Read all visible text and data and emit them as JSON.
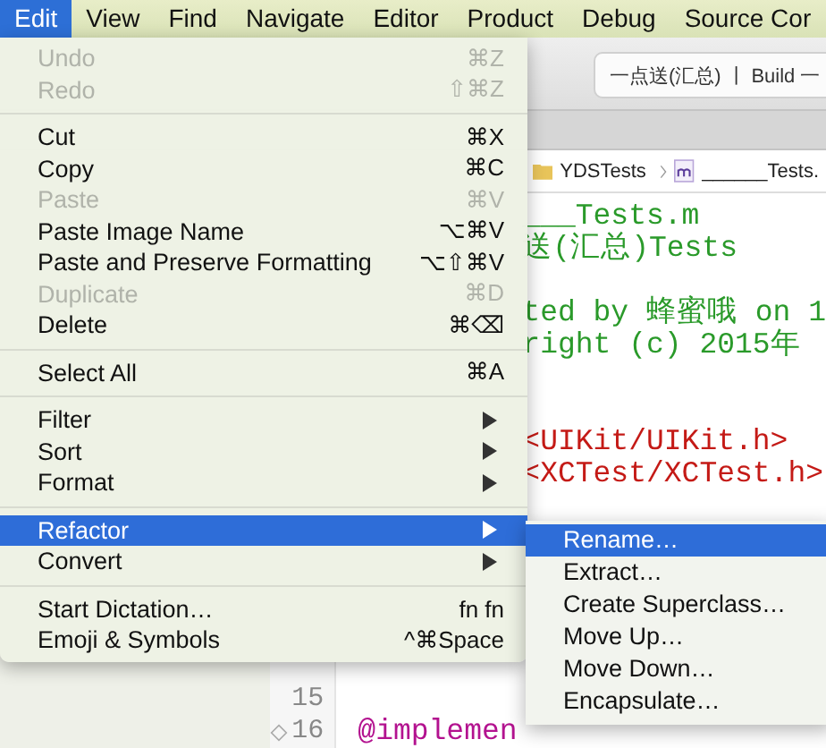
{
  "menubar": [
    {
      "label": "Edit",
      "selected": true
    },
    {
      "label": "View",
      "selected": false
    },
    {
      "label": "Find",
      "selected": false
    },
    {
      "label": "Navigate",
      "selected": false
    },
    {
      "label": "Editor",
      "selected": false
    },
    {
      "label": "Product",
      "selected": false
    },
    {
      "label": "Debug",
      "selected": false
    },
    {
      "label": "Source Cor",
      "selected": false
    }
  ],
  "toolbar": {
    "scheme": "一点送(汇总)",
    "divider": "|",
    "status": "Build 一"
  },
  "breadcrumb": [
    "YDSTests",
    "______Tests."
  ],
  "code_lines": [
    {
      "kind": "comment",
      "text": "___Tests.m"
    },
    {
      "kind": "comment",
      "text": "送(汇总)Tests"
    },
    {
      "kind": "blank"
    },
    {
      "kind": "comment",
      "text": "ted by 蜂蜜哦 on 1"
    },
    {
      "kind": "comment",
      "text": "right (c) 2015年"
    },
    {
      "kind": "blank"
    },
    {
      "kind": "blank"
    },
    {
      "kind": "directive",
      "text": "<UIKit/UIKit.h>"
    },
    {
      "kind": "directive",
      "text": "<XCTest/XCTest.h>"
    },
    {
      "kind": "blank"
    },
    {
      "kind": "blank"
    },
    {
      "kind": "blank"
    },
    {
      "kind": "blank"
    },
    {
      "kind": "blank"
    },
    {
      "kind": "blank"
    },
    {
      "kind": "blank",
      "number": "15"
    },
    {
      "kind": "keyword",
      "number": "16",
      "text": "@implemen"
    }
  ],
  "edit_menu": [
    {
      "kind": "item",
      "label": "Undo",
      "shortcut": "⌘Z",
      "disabled": true,
      "selected": false
    },
    {
      "kind": "item",
      "label": "Redo",
      "shortcut": "⇧⌘Z",
      "disabled": true,
      "selected": false
    },
    {
      "kind": "separator"
    },
    {
      "kind": "item",
      "label": "Cut",
      "shortcut": "⌘X",
      "disabled": false,
      "selected": false
    },
    {
      "kind": "item",
      "label": "Copy",
      "shortcut": "⌘C",
      "disabled": false,
      "selected": false
    },
    {
      "kind": "item",
      "label": "Paste",
      "shortcut": "⌘V",
      "disabled": true,
      "selected": false
    },
    {
      "kind": "item",
      "label": "Paste Image Name",
      "shortcut": "⌥⌘V",
      "disabled": false,
      "selected": false
    },
    {
      "kind": "item",
      "label": "Paste and Preserve Formatting",
      "shortcut": "⌥⇧⌘V",
      "disabled": false,
      "selected": false
    },
    {
      "kind": "item",
      "label": "Duplicate",
      "shortcut": "⌘D",
      "disabled": true,
      "selected": false
    },
    {
      "kind": "item",
      "label": "Delete",
      "shortcut": "⌘⌫",
      "disabled": false,
      "selected": false
    },
    {
      "kind": "separator"
    },
    {
      "kind": "item",
      "label": "Select All",
      "shortcut": "⌘A",
      "disabled": false,
      "selected": false
    },
    {
      "kind": "separator"
    },
    {
      "kind": "submenu",
      "label": "Filter",
      "disabled": false,
      "selected": false
    },
    {
      "kind": "submenu",
      "label": "Sort",
      "disabled": false,
      "selected": false
    },
    {
      "kind": "submenu",
      "label": "Format",
      "disabled": false,
      "selected": false
    },
    {
      "kind": "separator"
    },
    {
      "kind": "submenu",
      "label": "Refactor",
      "disabled": false,
      "selected": true
    },
    {
      "kind": "submenu",
      "label": "Convert",
      "disabled": false,
      "selected": false
    },
    {
      "kind": "separator"
    },
    {
      "kind": "item",
      "label": "Start Dictation…",
      "shortcut": "fn fn",
      "disabled": false,
      "selected": false
    },
    {
      "kind": "item",
      "label": "Emoji & Symbols",
      "shortcut": "^⌘Space",
      "disabled": false,
      "selected": false
    }
  ],
  "refactor_menu": [
    {
      "label": "Rename…",
      "selected": true
    },
    {
      "label": "Extract…",
      "selected": false
    },
    {
      "label": "Create Superclass…",
      "selected": false
    },
    {
      "label": "Move Up…",
      "selected": false
    },
    {
      "label": "Move Down…",
      "selected": false
    },
    {
      "label": "Encapsulate…",
      "selected": false
    }
  ]
}
